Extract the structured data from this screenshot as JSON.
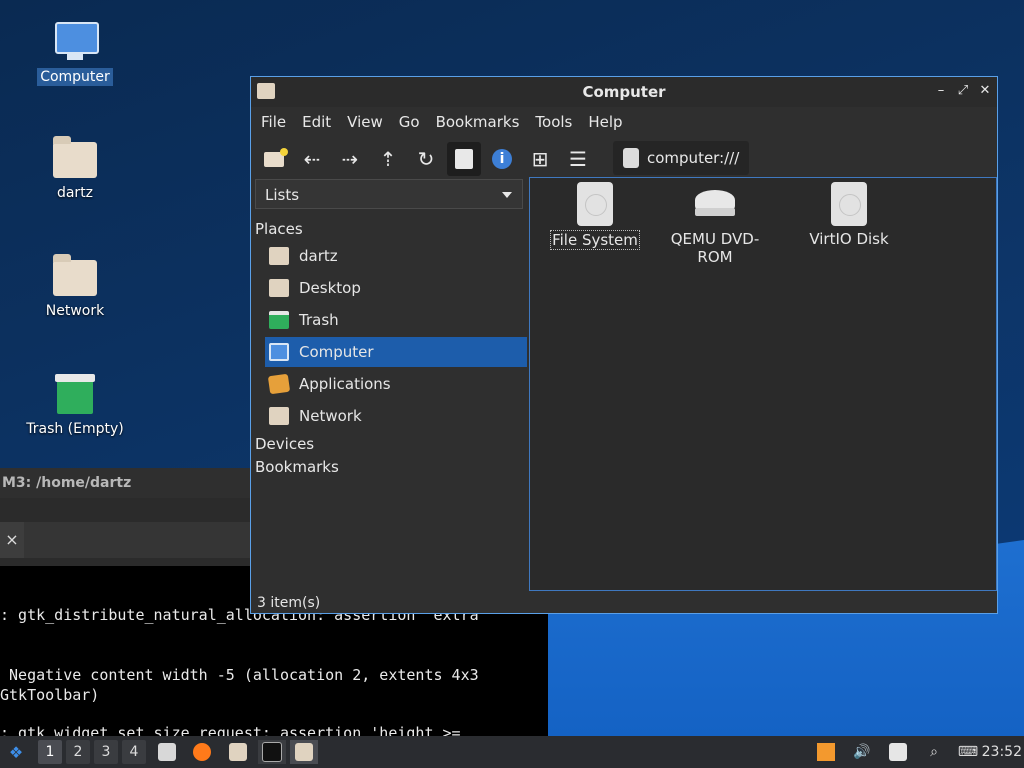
{
  "desktop": {
    "icons": [
      {
        "label": "Computer",
        "selected": true
      },
      {
        "label": "dartz"
      },
      {
        "label": "Network"
      },
      {
        "label": "Trash (Empty)"
      }
    ]
  },
  "terminal": {
    "title": "M3: /home/dartz",
    "tab_close": "×",
    "lines": [
      ": gtk_distribute_natural_allocation: assertion 'extra",
      " Negative content width -5 (allocation 2, extents 4x3",
      "GtkToolbar)",
      ": gtk_widget_set_size_request: assertion 'height >="
    ]
  },
  "file_manager": {
    "title": "Computer",
    "window_buttons": {
      "minimize": "–",
      "maximize": "⤢",
      "close": "✕"
    },
    "menu": [
      "File",
      "Edit",
      "View",
      "Go",
      "Bookmarks",
      "Tools",
      "Help"
    ],
    "toolbar": {
      "icons": [
        "new-folder-icon",
        "back-icon",
        "forward-icon",
        "up-icon",
        "reload-icon",
        "icon-view-icon",
        "info-icon",
        "grid-icon",
        "list-icon"
      ],
      "path": "computer:///"
    },
    "side_pane": {
      "mode": "Lists",
      "places_header": "Places",
      "places": [
        {
          "label": "dartz",
          "icon": "home-folder-icon"
        },
        {
          "label": "Desktop",
          "icon": "desktop-folder-icon"
        },
        {
          "label": "Trash",
          "icon": "trash-icon"
        },
        {
          "label": "Computer",
          "icon": "computer-icon",
          "selected": true
        },
        {
          "label": "Applications",
          "icon": "applications-icon"
        },
        {
          "label": "Network",
          "icon": "network-folder-icon"
        }
      ],
      "devices_header": "Devices",
      "bookmarks_header": "Bookmarks"
    },
    "items": [
      {
        "label": "File System",
        "icon": "disk-icon",
        "focused": true
      },
      {
        "label": "QEMU DVD-ROM",
        "icon": "dvd-icon"
      },
      {
        "label": "VirtIO Disk",
        "icon": "disk-icon"
      }
    ],
    "status": "3 item(s)"
  },
  "taskbar": {
    "workspaces": [
      "1",
      "2",
      "3",
      "4"
    ],
    "clock": "23:52"
  },
  "colors": {
    "accent": "#1d5dab",
    "window_border": "#5aa0e8"
  }
}
